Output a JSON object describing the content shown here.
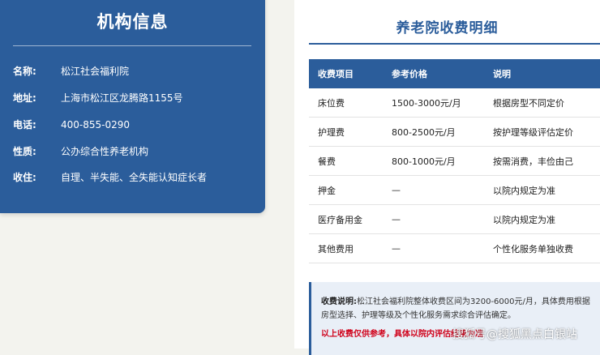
{
  "info": {
    "title": "机构信息",
    "rows": [
      {
        "label": "名称:",
        "value": "松江社会福利院"
      },
      {
        "label": "地址:",
        "value": "上海市松江区龙腾路1155号"
      },
      {
        "label": "电话:",
        "value": "400-855-0290"
      },
      {
        "label": "性质:",
        "value": "公办综合性养老机构"
      },
      {
        "label": "收住:",
        "value": "自理、半失能、全失能认知症长者"
      }
    ]
  },
  "fees": {
    "title": "养老院收费明细",
    "headers": [
      "收费项目",
      "参考价格",
      "说明"
    ],
    "rows": [
      [
        "床位费",
        "1500-3000元/月",
        "根据房型不同定价"
      ],
      [
        "护理费",
        "800-2500元/月",
        "按护理等级评估定价"
      ],
      [
        "餐费",
        "800-1000元/月",
        "按需消费，丰俭由己"
      ],
      [
        "押金",
        "—",
        "以院内规定为准"
      ],
      [
        "医疗备用金",
        "—",
        "以院内规定为准"
      ],
      [
        "其他费用",
        "—",
        "个性化服务单独收费"
      ]
    ]
  },
  "note": {
    "label": "收费说明:",
    "text": "松江社会福利院整体收费区间为3200-6000元/月，具体费用根据房型选择、护理等级及个性化服务需求综合评估确定。",
    "warning": "以上收费仅供参考，具体以院内评估结果为准"
  },
  "watermark": "搜狐号@搜狐黑点白银站"
}
